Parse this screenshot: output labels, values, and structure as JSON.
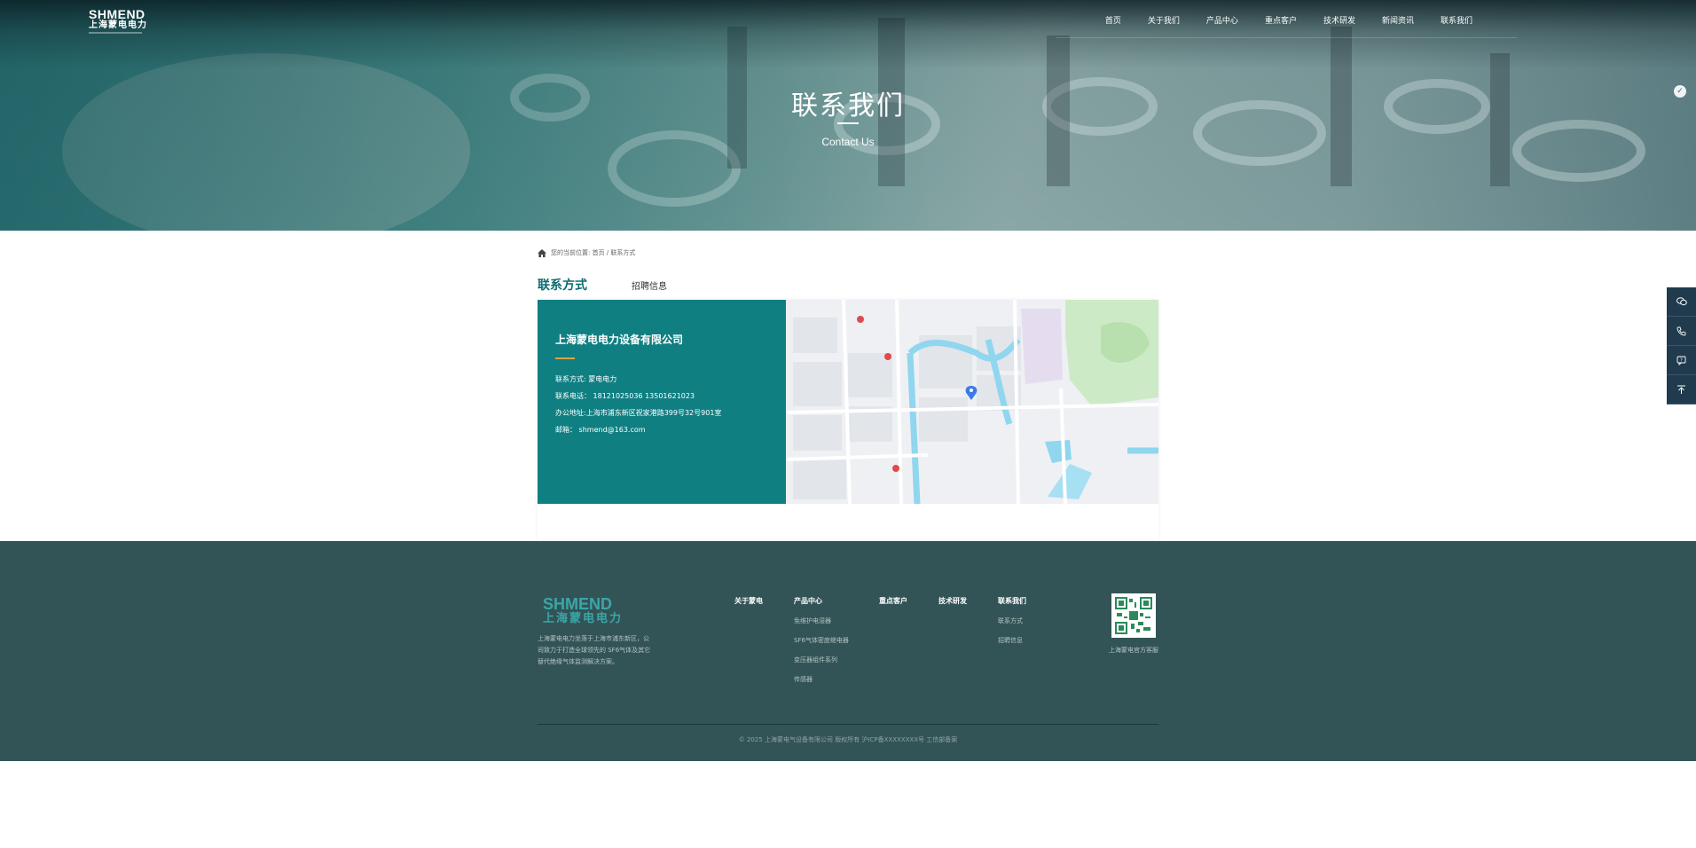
{
  "header": {
    "logo_en": "SHMEND",
    "logo_cn": "上海蒙电电力",
    "nav": [
      "首页",
      "关于我们",
      "产品中心",
      "重点客户",
      "技术研发",
      "新闻资讯",
      "联系我们"
    ]
  },
  "hero": {
    "title": "联系我们",
    "subtitle": "Contact Us"
  },
  "breadcrumb": {
    "text": "您的当前位置: 首页 / 联系方式"
  },
  "tabs": {
    "active": "联系方式",
    "other": "招聘信息"
  },
  "contact": {
    "company": "上海蒙电电力设备有限公司",
    "contact_line": "联系方式: 蒙电电力",
    "phone_line": "联系电话： 18121025036 13501621023",
    "address_line": "办公地址:上海市浦东新区祝家港路399号32号901室",
    "email_line": "邮箱： shmend@163.com"
  },
  "footer": {
    "logo_en": "SHMEND",
    "logo_cn": "上海蒙电电力",
    "description": "上海蒙电电力坐落于上海市浦东新区，公司致力于打造全球领先的 SF6气体及其它替代绝缘气体监测解决方案。",
    "columns": [
      {
        "heading": "关于蒙电",
        "links": []
      },
      {
        "heading": "产品中心",
        "links": [
          "免维护电湿器",
          "SF6气体密度继电器",
          "变压器组件系列",
          "传感器"
        ]
      },
      {
        "heading": "重点客户",
        "links": []
      },
      {
        "heading": "技术研发",
        "links": []
      },
      {
        "heading": "联系我们",
        "links": [
          "联系方式",
          "招聘信息"
        ]
      }
    ],
    "qr_caption": "上海蒙电官方客服",
    "copyright": "© 2025 上海蒙电气设备有限公司 版权所有 沪ICP备XXXXXXXX号 工信部备案"
  },
  "colors": {
    "accent": "#0d6b72",
    "info_bg": "#107f82",
    "footer_bg": "#335456",
    "gold": "#d9a441",
    "float_bg": "#1f3b4d"
  }
}
